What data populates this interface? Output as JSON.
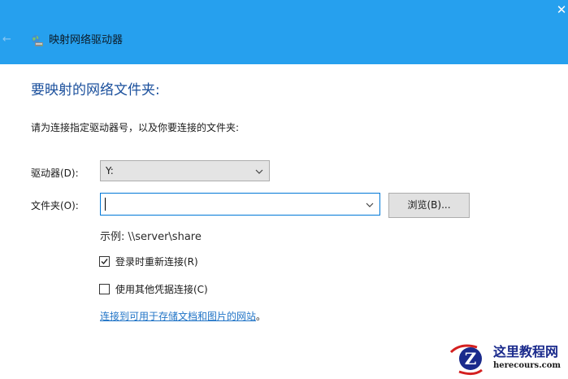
{
  "window": {
    "title": "映射网络驱动器",
    "close_glyph": "✕",
    "back_glyph": "←",
    "icons": [
      "network-drive-icon",
      "back-arrow-icon",
      "close-icon"
    ]
  },
  "main": {
    "heading": "要映射的网络文件夹:",
    "instruction": "请为连接指定驱动器号，以及你要连接的文件夹:"
  },
  "drive": {
    "label": "驱动器(D):",
    "selected_value": "Y:"
  },
  "folder": {
    "label": "文件夹(O):",
    "value": ""
  },
  "browse_button": "浏览(B)...",
  "example": "示例: \\\\server\\share",
  "options": {
    "reconnect": {
      "label": "登录时重新连接(R)",
      "checked": true
    },
    "other_credentials": {
      "label": "使用其他凭据连接(C)",
      "checked": false
    }
  },
  "link": {
    "text": "连接到可用于存储文档和图片的网站",
    "suffix": "。"
  },
  "watermark": {
    "name": "这里教程网",
    "url": "herecours.com"
  },
  "colors": {
    "titlebar": "#26a0ee",
    "heading": "#1a4f9c",
    "link": "#1f73c6",
    "input_focus": "#0078d7"
  }
}
